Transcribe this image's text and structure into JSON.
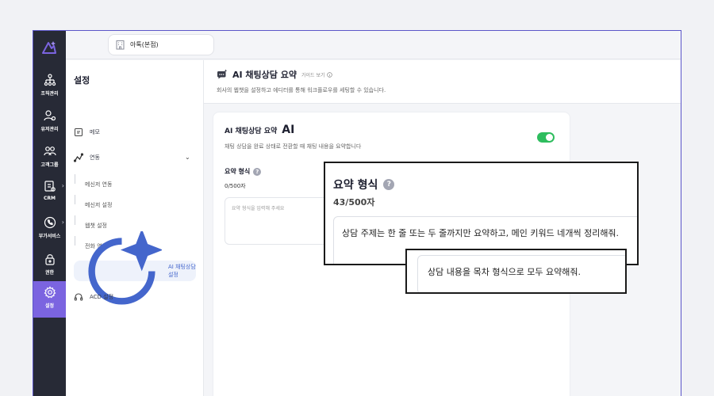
{
  "rail": {
    "items": [
      {
        "label": "조직관리",
        "icon": "org-chart-icon"
      },
      {
        "label": "유저관리",
        "icon": "user-gear-icon"
      },
      {
        "label": "고객그룹",
        "icon": "customer-group-icon"
      },
      {
        "label": "CRM",
        "icon": "crm-icon"
      },
      {
        "label": "부가서비스",
        "icon": "phone-service-icon"
      },
      {
        "label": "권한",
        "icon": "lock-icon"
      },
      {
        "label": "설정",
        "icon": "gear-icon"
      }
    ]
  },
  "topbar": {
    "store_name": "아톡(본점)"
  },
  "subnav": {
    "title": "설정",
    "memo": "메모",
    "integration": "연동",
    "sub_items": [
      "메신저 연동",
      "메신저 설정",
      "웹챗 설정",
      "전화 연동"
    ],
    "ai_summary": "AI 채팅상담 설정",
    "acd": "ACD 설정"
  },
  "main": {
    "title": "AI 채팅상담 요약",
    "guide": "가이드 보기",
    "description": "회사의 웹챗을 설정하고 에디터를 통해 워크플로우를 세팅할 수 있습니다."
  },
  "card": {
    "title": "AI 채팅상담 요약",
    "ai_mark": "AI",
    "description": "채팅 상담을 완료 상태로 전환할 때 채팅 내용을 요약합니다",
    "toggle_on": true,
    "format_label": "요약 형식",
    "format_count": "0/500자",
    "format_placeholder": "요약 형식을 입력해 주세요"
  },
  "zoom1": {
    "label": "요약 형식",
    "count": "43/500자",
    "value": "상담 주제는 한 줄 또는 두 줄까지만 요약하고, 메인 키워드 네개씩 정리해줘."
  },
  "zoom2": {
    "value": "상담 내용을 목차 형식으로 모두 요약해줘."
  },
  "colors": {
    "rail_bg": "#272a36",
    "accent": "#7b64e0",
    "toggle_on": "#2ebd5e",
    "active_link": "#4466cc"
  }
}
